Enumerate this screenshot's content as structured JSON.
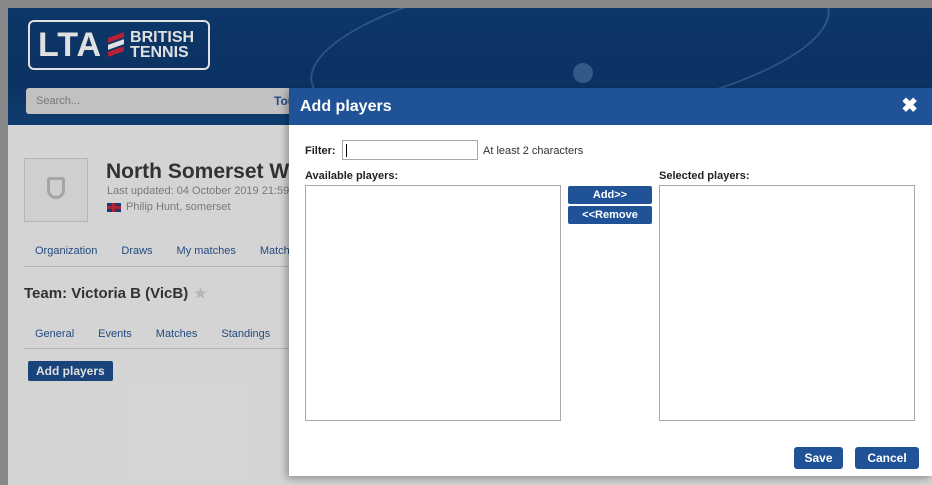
{
  "header": {
    "logo_main": "LTA",
    "logo_sub1": "BRITISH",
    "logo_sub2": "TENNIS",
    "search_placeholder": "Search...",
    "tournament_label": "Tourn"
  },
  "organization": {
    "name": "North Somerset Wi",
    "last_updated": "Last updated: 04 October 2019 21:59",
    "user": "Philip Hunt, somerset"
  },
  "nav_primary": [
    "Organization",
    "Draws",
    "My matches",
    "Match"
  ],
  "team": {
    "title": "Team: Victoria B (VicB)",
    "tabs": [
      "General",
      "Events",
      "Matches",
      "Standings"
    ],
    "add_players_label": "Add players"
  },
  "modal": {
    "title": "Add players",
    "close_icon": "close-icon",
    "filter_label": "Filter:",
    "filter_value": "",
    "filter_hint": "At least 2 characters",
    "available_label": "Available players:",
    "selected_label": "Selected players:",
    "available_players": [],
    "selected_players": [],
    "add_label": "Add>>",
    "remove_label": "<<Remove",
    "save_label": "Save",
    "cancel_label": "Cancel"
  },
  "colors": {
    "brand_blue": "#1f5297",
    "hero_blue": "#0f3f78"
  }
}
